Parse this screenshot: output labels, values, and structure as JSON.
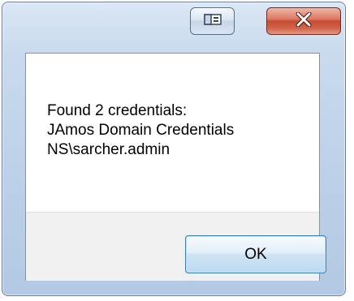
{
  "window": {
    "title": "",
    "restore_icon": "restore-window-icon",
    "close_icon": "close-x-icon"
  },
  "message": {
    "lines": [
      "Found 2 credentials:",
      "JAmos Domain Credentials",
      "NS\\sarcher.admin"
    ]
  },
  "buttons": {
    "ok_label": "OK"
  },
  "colors": {
    "frame": "#bcd0e8",
    "close": "#c74a33",
    "ok_border": "#3c7fb1",
    "button_area": "#f0f0f0"
  }
}
